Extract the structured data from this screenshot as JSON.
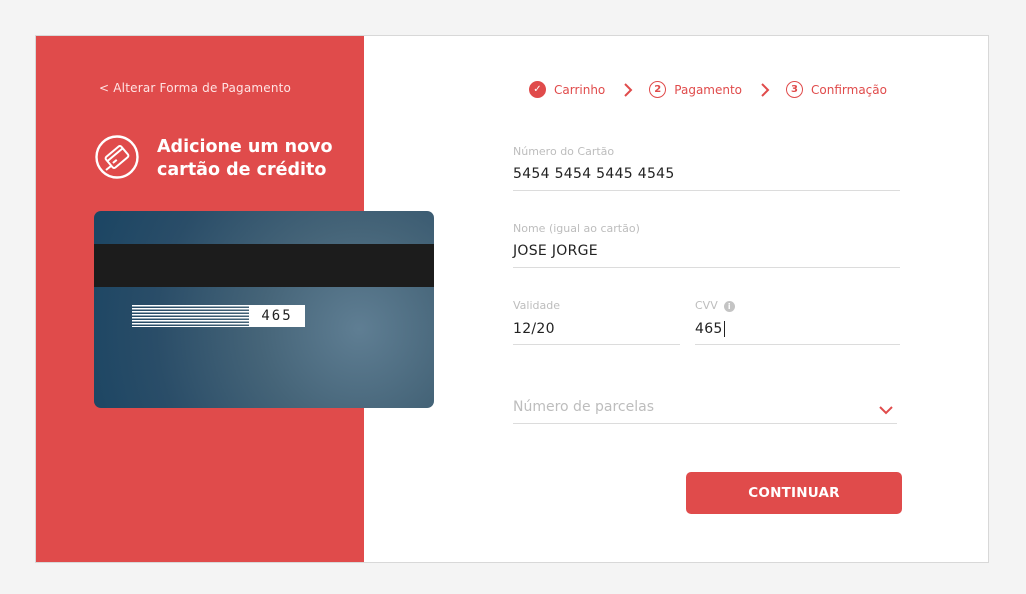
{
  "left_panel": {
    "back_link": "< Alterar Forma de Pagamento",
    "title_line1": "Adicione um novo",
    "title_line2": "cartão de crédito",
    "icon": "credit-card-icon",
    "card_preview": {
      "cvv_display": "465"
    }
  },
  "steps": [
    {
      "label": "Carrinho",
      "marker": "✓",
      "state": "done"
    },
    {
      "label": "Pagamento",
      "marker": "2",
      "state": "current"
    },
    {
      "label": "Confirmação",
      "marker": "3",
      "state": "upcoming"
    }
  ],
  "form": {
    "card_number": {
      "label": "Número do Cartão",
      "value": "5454 5454 5445 4545"
    },
    "name": {
      "label": "Nome (igual ao cartão)",
      "value": "JOSE JORGE"
    },
    "expiry": {
      "label": "Validade",
      "value": "12/20"
    },
    "cvv": {
      "label": "CVV",
      "value": "465",
      "info_icon": "info-icon"
    },
    "installments": {
      "placeholder": "Número de parcelas"
    }
  },
  "submit_label": "CONTINUAR",
  "colors": {
    "accent": "#e04b4b",
    "card_dark": "#1b4563",
    "card_light": "#5f7e93"
  }
}
